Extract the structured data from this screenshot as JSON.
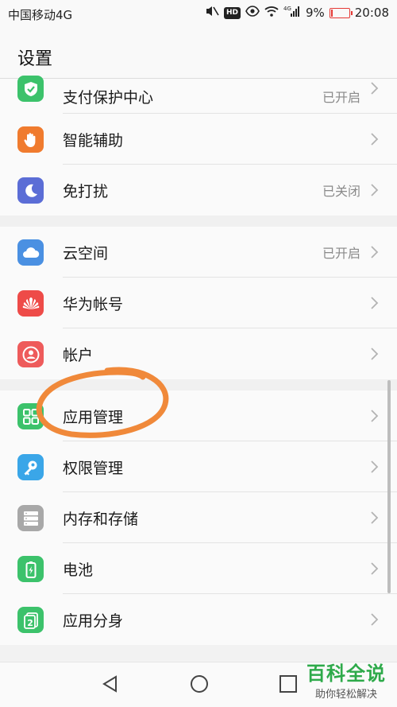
{
  "status_bar": {
    "carrier": "中国移动4G",
    "network_label": "4G",
    "battery_text": "9%",
    "battery_level": 0.09,
    "time": "20:08",
    "icons": [
      "mute-icon",
      "hd-icon",
      "eye-icon",
      "wifi-icon",
      "signal-icon",
      "battery-icon"
    ]
  },
  "header": {
    "title": "设置"
  },
  "groups": [
    {
      "items": [
        {
          "label": "支付保护中心",
          "status": "已开启",
          "icon": "shield-check-icon",
          "color": "#3cc26b"
        },
        {
          "label": "智能辅助",
          "status": "",
          "icon": "hand-icon",
          "color": "#f07b2e"
        },
        {
          "label": "免打扰",
          "status": "已关闭",
          "icon": "moon-icon",
          "color": "#5b6dd6"
        }
      ]
    },
    {
      "items": [
        {
          "label": "云空间",
          "status": "已开启",
          "icon": "cloud-icon",
          "color": "#4a90e2"
        },
        {
          "label": "华为帐号",
          "status": "",
          "icon": "huawei-logo-icon",
          "color": "#ee4b48"
        },
        {
          "label": "帐户",
          "status": "",
          "icon": "account-icon",
          "color": "#ee5b5b"
        }
      ]
    },
    {
      "items": [
        {
          "label": "应用管理",
          "status": "",
          "icon": "apps-grid-icon",
          "color": "#3cc26b"
        },
        {
          "label": "权限管理",
          "status": "",
          "icon": "key-icon",
          "color": "#3aa6e8"
        },
        {
          "label": "内存和存储",
          "status": "",
          "icon": "storage-icon",
          "color": "#a8a8a8"
        },
        {
          "label": "电池",
          "status": "",
          "icon": "battery-status-icon",
          "color": "#3cc26b"
        },
        {
          "label": "应用分身",
          "status": "",
          "icon": "app-twin-icon",
          "color": "#3cc26b"
        }
      ]
    }
  ],
  "annotation": {
    "color": "#f0893a",
    "target": "应用管理"
  },
  "nav": {
    "icons": [
      "back-icon",
      "home-icon",
      "recent-apps-icon"
    ]
  },
  "watermark": {
    "title": "百科全说",
    "subtitle": "助你轻松解决"
  }
}
